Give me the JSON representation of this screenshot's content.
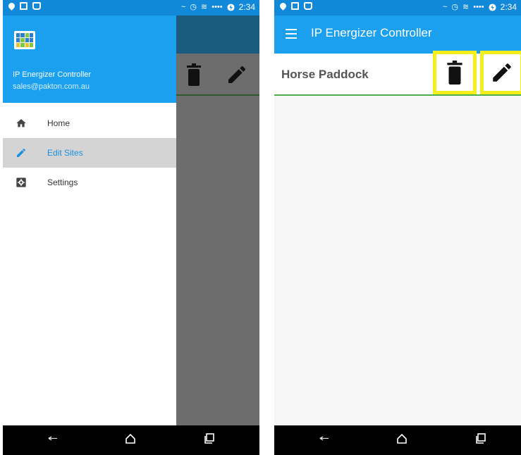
{
  "status_bar": {
    "time": "2:34",
    "signal_glyph": "~",
    "alarm_glyph": "◷",
    "wifi_glyph": "≋",
    "dots_glyph": "••••"
  },
  "left_phone": {
    "drawer": {
      "app_name": "IP Energizer Controller",
      "email": "sales@pakton.com.au",
      "items": [
        {
          "label": "Home",
          "icon": "home-icon",
          "active": false
        },
        {
          "label": "Edit Sites",
          "icon": "pencil-icon",
          "active": true
        },
        {
          "label": "Settings",
          "icon": "settings-icon",
          "active": false
        }
      ]
    }
  },
  "right_phone": {
    "app_title": "IP Energizer Controller",
    "site_title": "Horse Paddock",
    "actions": [
      {
        "name": "delete",
        "icon": "trash-icon",
        "highlighted": true
      },
      {
        "name": "edit",
        "icon": "pencil-icon",
        "highlighted": true
      }
    ]
  },
  "colors": {
    "status_bar": "#1289d8",
    "app_bar": "#1aa0ee",
    "active_item_text": "#1a8fe0",
    "active_item_bg": "#d4d4d4",
    "highlight": "#f6ee1b",
    "underline": "#4bb04b",
    "scrim": "#6d6d6d"
  }
}
